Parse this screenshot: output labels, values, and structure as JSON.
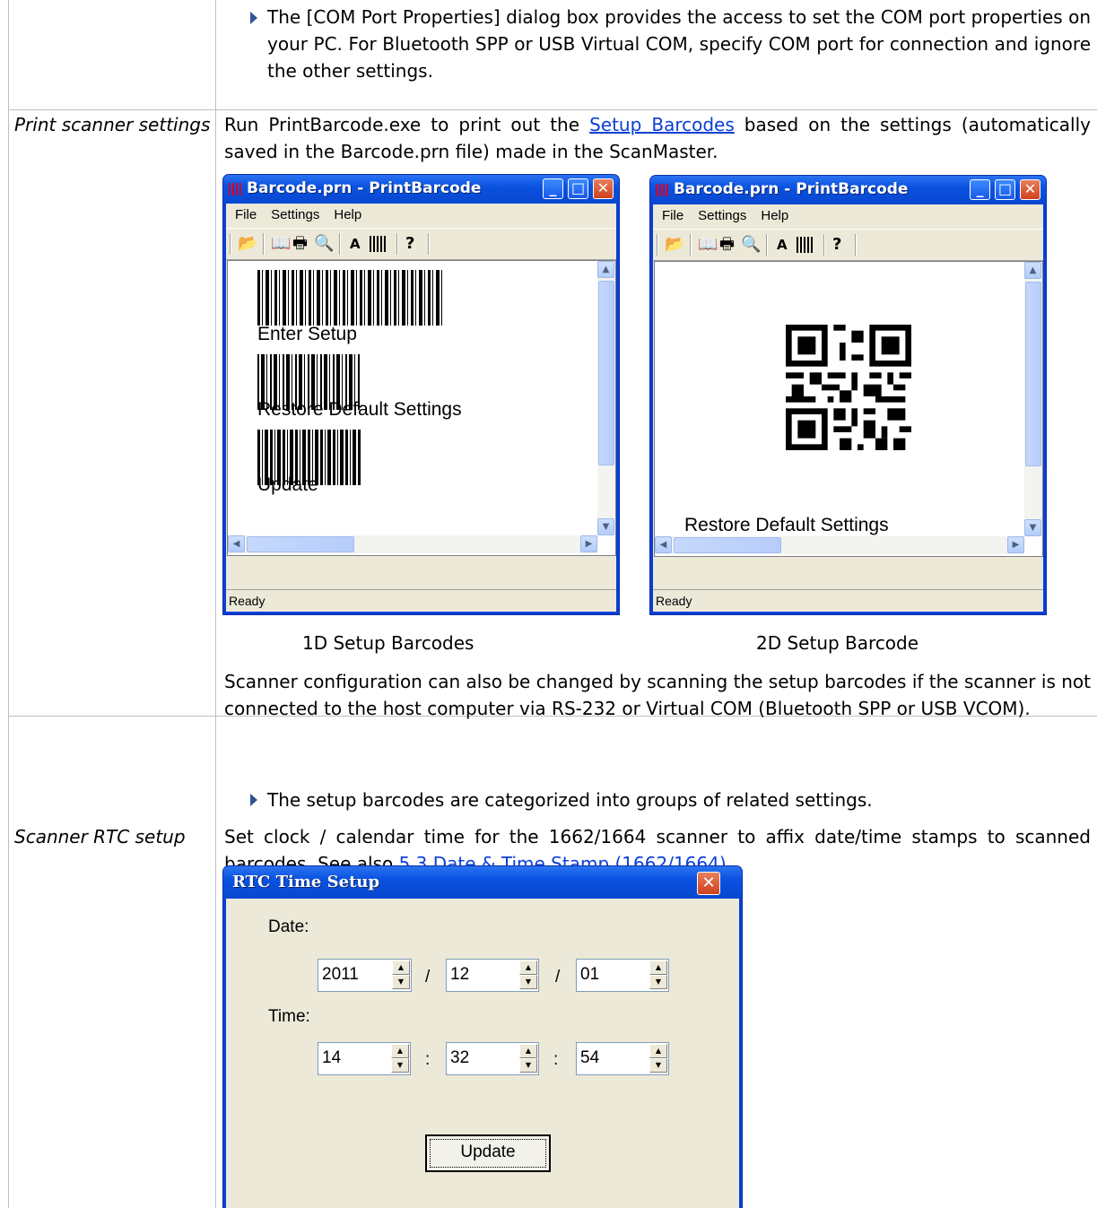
{
  "rows": {
    "top": {
      "bullet": "The [COM Port Properties] dialog box provides the access to set the COM port properties on your PC. For Bluetooth SPP or USB Virtual COM, specify COM port for connection and ignore the other settings."
    },
    "print": {
      "label": "Print scanner settings",
      "intro_before": "Run PrintBarcode.exe to print out the ",
      "intro_link": "Setup Barcodes",
      "intro_after": " based on the settings (automatically saved in the Barcode.prn file) made in the ScanMaster.",
      "caption_1d": "1D Setup Barcodes",
      "caption_2d": "2D Setup Barcode",
      "para2": "Scanner configuration can also be changed by scanning the setup barcodes if the scanner is not connected to the host computer via RS-232 or Virtual COM (Bluetooth SPP or USB VCOM).",
      "bullet": "The setup barcodes are categorized into groups of related settings."
    },
    "rtc": {
      "label": "Scanner RTC setup",
      "intro_before": "Set clock / calendar time for the 1662/1664 scanner to affix date/time stamps to scanned barcodes. See also ",
      "intro_link": "5.3 Date & Time Stamp (1662/1664)",
      "intro_after": "."
    }
  },
  "print_window": {
    "title": "Barcode.prn - PrintBarcode",
    "menu": [
      "File",
      "Settings",
      "Help"
    ],
    "status": "Ready",
    "labels_1d": [
      "Enter Setup",
      "Restore Default Settings",
      "Update"
    ],
    "label_2d": "Restore Default Settings"
  },
  "rtc_dialog": {
    "title": "RTC Time Setup",
    "date_label": "Date:",
    "time_label": "Time:",
    "year": "2011",
    "month": "12",
    "day": "01",
    "hour": "14",
    "minute": "32",
    "second": "54",
    "date_sep": "/",
    "time_sep": ":",
    "update_label": "Update"
  },
  "icons": [
    "open-folder-icon",
    "book-icon",
    "print-icon",
    "print-preview-icon",
    "font-icon",
    "barcode-icon",
    "help-icon",
    "minimize-icon",
    "maximize-icon",
    "close-icon"
  ]
}
